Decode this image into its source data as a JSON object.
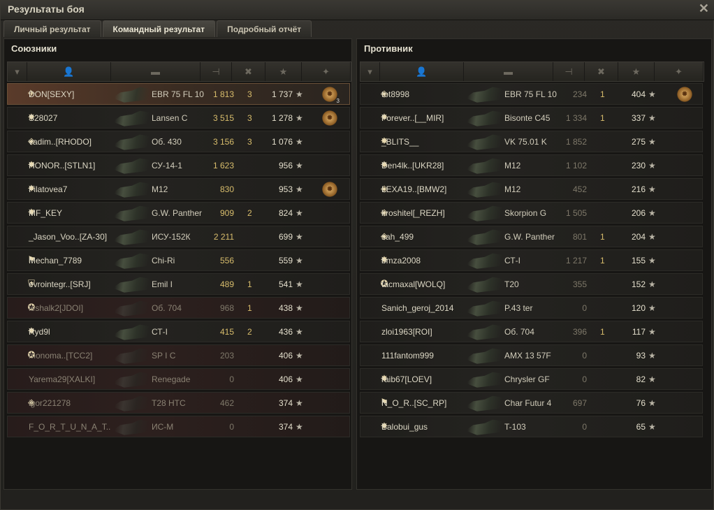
{
  "window": {
    "title": "Результаты боя",
    "close_icon": "close-icon"
  },
  "tabs": [
    {
      "label": "Личный результат"
    },
    {
      "label": "Командный результат",
      "active": true
    },
    {
      "label": "Подробный отчёт"
    }
  ],
  "allies": {
    "title": "Союзники",
    "rows": [
      {
        "name": "DON[SEXY]",
        "tank": "EBR 75 FL 10",
        "damage": "1 813",
        "kills": "3",
        "xp": "1 737",
        "medal": true,
        "medal_count": "3",
        "me": true,
        "icon": "wings-icon"
      },
      {
        "name": "S28027",
        "tank": "Lansen C",
        "damage": "3 515",
        "kills": "3",
        "xp": "1 278",
        "medal": true,
        "icon": "star-badge-icon"
      },
      {
        "name": "vadim..[RHODO]",
        "tank": "Об. 430",
        "damage": "3 156",
        "kills": "3",
        "xp": "1 076",
        "icon": "diamond-icon"
      },
      {
        "name": "HONOR..[STLN1]",
        "tank": "СУ-14-1",
        "damage": "1 623",
        "kills": "",
        "xp": "956",
        "icon": "star-badge-icon"
      },
      {
        "name": "Filatovea7",
        "tank": "M12",
        "damage": "830",
        "kills": "",
        "xp": "953",
        "medal": true,
        "icon": "star-badge-icon"
      },
      {
        "name": "MF_KEY",
        "tank": "G.W. Panther",
        "damage": "909",
        "kills": "2",
        "xp": "824",
        "icon": "star-badge-icon"
      },
      {
        "name": "_Jason_Voo..[ZA-30]",
        "tank": "ИСУ-152К",
        "damage": "2 211",
        "kills": "",
        "xp": "699",
        "icon": ""
      },
      {
        "name": "Mechan_7789",
        "tank": "Chi-Ri",
        "damage": "556",
        "kills": "",
        "xp": "559",
        "icon": "flag-icon"
      },
      {
        "name": "evrointegr..[SRJ]",
        "tank": "Emil I",
        "damage": "489",
        "kills": "1",
        "xp": "541",
        "icon": "shield-icon"
      },
      {
        "name": "leshalk2[JDOI]",
        "tank": "Об. 704",
        "damage": "968",
        "kills": "1",
        "xp": "438",
        "dead": true,
        "icon": "clan-icon"
      },
      {
        "name": "Ryd9l",
        "tank": "СТ-I",
        "damage": "415",
        "kills": "2",
        "xp": "436",
        "icon": "star-badge-icon"
      },
      {
        "name": "monoma..[TCC2]",
        "tank": "SP I C",
        "damage": "203",
        "kills": "",
        "xp": "406",
        "dead": true,
        "icon": "clan-icon"
      },
      {
        "name": "Yarema29[XALKI]",
        "tank": "Renegade",
        "damage": "0",
        "kills": "",
        "xp": "406",
        "dead": true,
        "icon": ""
      },
      {
        "name": "igor221278",
        "tank": "T28 HTC",
        "damage": "462",
        "kills": "",
        "xp": "374",
        "dead": true,
        "icon": "diamond-icon"
      },
      {
        "name": "F_O_R_T_U_N_A_T..",
        "tank": "ИС-М",
        "damage": "0",
        "kills": "",
        "xp": "374",
        "dead": true,
        "icon": ""
      }
    ]
  },
  "enemies": {
    "title": "Противник",
    "rows": [
      {
        "name": "tot8998",
        "tank": "EBR 75 FL 10",
        "damage": "234",
        "kills": "1",
        "xp": "404",
        "medal": true,
        "icon": "diamond-icon"
      },
      {
        "name": "Forever..[__MIR]",
        "tank": "Bisonte C45",
        "damage": "1 334",
        "kills": "1",
        "xp": "337",
        "icon": "star-badge-icon"
      },
      {
        "name": "_BLITS__",
        "tank": "VK 75.01 K",
        "damage": "1 852",
        "kills": "",
        "xp": "275",
        "icon": "star-badge-icon"
      },
      {
        "name": "Den4lk..[UKR28]",
        "tank": "M12",
        "damage": "1 102",
        "kills": "",
        "xp": "230",
        "icon": "star-badge-icon"
      },
      {
        "name": "LEXA19..[BMW2]",
        "tank": "M12",
        "damage": "452",
        "kills": "",
        "xp": "216",
        "icon": "diamond-icon"
      },
      {
        "name": "kroshitel[_REZH]",
        "tank": "Skorpion G",
        "damage": "1 505",
        "kills": "",
        "xp": "206",
        "icon": "diamond-icon"
      },
      {
        "name": "sah_499",
        "tank": "G.W. Panther",
        "damage": "801",
        "kills": "1",
        "xp": "204",
        "icon": "diamond-icon"
      },
      {
        "name": "bmza2008",
        "tank": "СТ-I",
        "damage": "1 217",
        "kills": "1",
        "xp": "155",
        "icon": "star-badge-icon"
      },
      {
        "name": "tacmaxal[WOLQ]",
        "tank": "T20",
        "damage": "355",
        "kills": "",
        "xp": "152",
        "icon": "clan-icon"
      },
      {
        "name": "Sanich_geroj_2014",
        "tank": "P.43 ter",
        "damage": "0",
        "kills": "",
        "xp": "120",
        "icon": ""
      },
      {
        "name": "zloi1963[ROI]",
        "tank": "Об. 704",
        "damage": "396",
        "kills": "1",
        "xp": "117",
        "icon": ""
      },
      {
        "name": "111fantom999",
        "tank": "AMX 13 57F",
        "damage": "0",
        "kills": "",
        "xp": "93",
        "icon": ""
      },
      {
        "name": "raib67[LOEV]",
        "tank": "Chrysler GF",
        "damage": "0",
        "kills": "",
        "xp": "82",
        "icon": "star-badge-icon"
      },
      {
        "name": "N_O_R..[SC_RP]",
        "tank": "Char Futur 4",
        "damage": "697",
        "kills": "",
        "xp": "76",
        "icon": "flag-icon"
      },
      {
        "name": "Balobui_gus",
        "tank": "T-103",
        "damage": "0",
        "kills": "",
        "xp": "65",
        "icon": "star-badge-icon"
      }
    ]
  },
  "star_glyph": "★",
  "icon_glyphs": {
    "wings-icon": "✈",
    "star-badge-icon": "✸",
    "diamond-icon": "◈",
    "flag-icon": "⚑",
    "shield-icon": "⛨",
    "clan-icon": "✪",
    "": ""
  }
}
